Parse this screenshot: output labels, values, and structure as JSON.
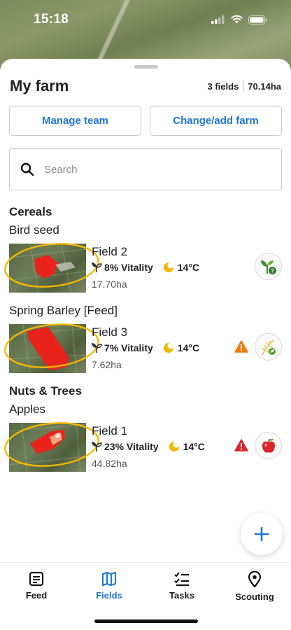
{
  "status_bar": {
    "time": "15:18"
  },
  "farm": {
    "title": "My farm",
    "field_count": "3 fields",
    "total_area": "70.14ha"
  },
  "actions": {
    "manage_team": "Manage team",
    "change_farm": "Change/add farm"
  },
  "search": {
    "placeholder": "Search"
  },
  "groups": [
    {
      "category": "Cereals",
      "crops": [
        {
          "name": "Bird seed",
          "fields": [
            {
              "name": "Field 2",
              "vitality": "8% Vitality",
              "temperature": "14°C",
              "area": "17.70ha",
              "warning": null,
              "crop_icon": "plant-question-icon"
            }
          ]
        },
        {
          "name": "Spring Barley [Feed]",
          "fields": [
            {
              "name": "Field 3",
              "vitality": "7% Vitality",
              "temperature": "14°C",
              "area": "7.62ha",
              "warning": "orange",
              "crop_icon": "barley-icon"
            }
          ]
        }
      ]
    },
    {
      "category": "Nuts & Trees",
      "crops": [
        {
          "name": "Apples",
          "fields": [
            {
              "name": "Field 1",
              "vitality": "23% Vitality",
              "temperature": "14°C",
              "area": "44.82ha",
              "warning": "red",
              "crop_icon": "apple-icon"
            }
          ]
        }
      ]
    }
  ],
  "tabs": [
    {
      "label": "Feed",
      "icon": "feed-icon",
      "active": false
    },
    {
      "label": "Fields",
      "icon": "map-icon",
      "active": true
    },
    {
      "label": "Tasks",
      "icon": "tasks-icon",
      "active": false
    },
    {
      "label": "Scouting",
      "icon": "location-pin-icon",
      "active": false
    }
  ],
  "colors": {
    "accent": "#1f76d6",
    "warning_orange": "#f07a0c",
    "warning_red": "#d9252b",
    "highlight_ring": "#f5b800",
    "heat_red": "#e8231c"
  }
}
